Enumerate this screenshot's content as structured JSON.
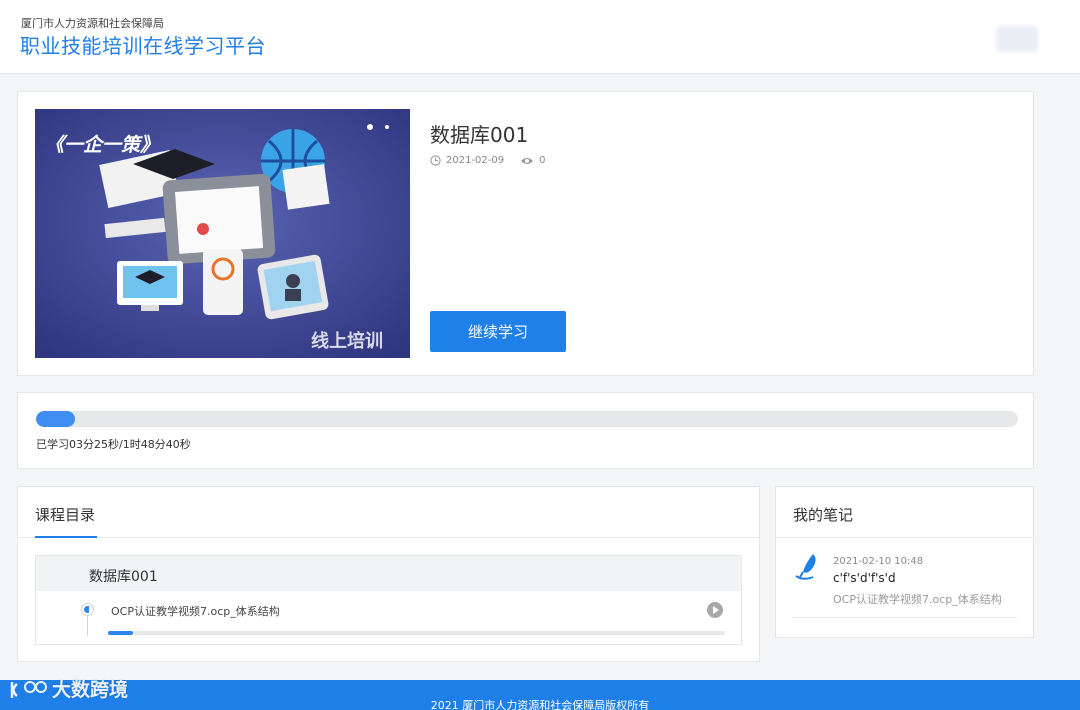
{
  "header": {
    "org": "厦门市人力资源和社会保障局",
    "platform": "职业技能培训在线学习平台"
  },
  "course": {
    "title": "数据库001",
    "date": "2021-02-09",
    "views": "0",
    "continue_label": "继续学习",
    "cover": {
      "heading": "《一企一策》",
      "caption": "线上培训"
    }
  },
  "progress": {
    "fraction": 0.04,
    "text": "已学习03分25秒/1时48分40秒"
  },
  "catalog": {
    "title": "课程目录",
    "chapter": "数据库001",
    "lesson": "OCP认证教学视频7.ocp_体系结构",
    "lesson_progress": 0.04
  },
  "notes": {
    "title": "我的笔记",
    "items": [
      {
        "time": "2021-02-10 10:48",
        "text": "c'f's'd'f's'd",
        "source": "OCP认证教学视频7.ocp_体系结构"
      }
    ]
  },
  "footer": {
    "copyright": "2021 厦门市人力资源和社会保障局版权所有"
  },
  "watermark": "大数跨境",
  "colors": {
    "accent": "#1f7fe8",
    "progress": "#3d8ef0"
  }
}
